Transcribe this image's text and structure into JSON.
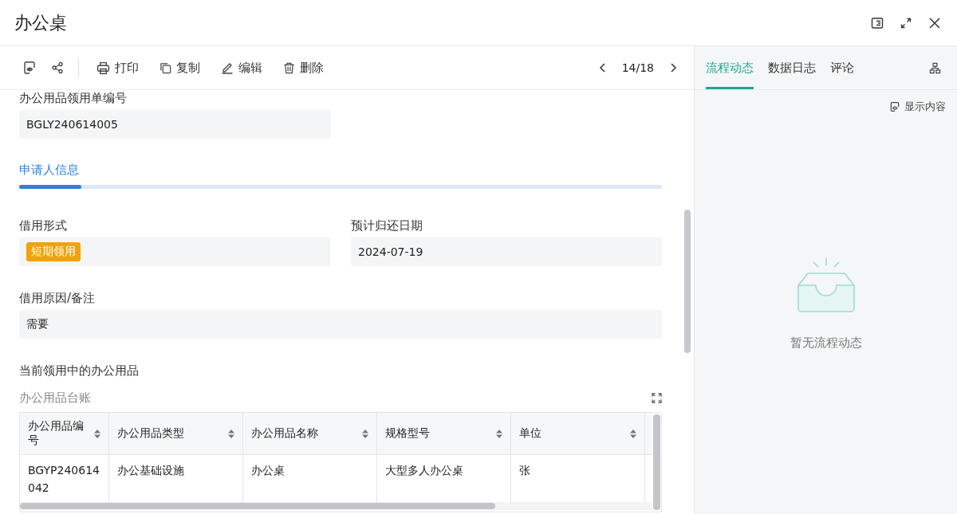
{
  "window": {
    "title": "办公桌"
  },
  "toolbar": {
    "actions": [
      {
        "kind": "print",
        "label": "打印"
      },
      {
        "kind": "copy",
        "label": "复制"
      },
      {
        "kind": "edit",
        "label": "编辑"
      },
      {
        "kind": "delete",
        "label": "删除"
      }
    ],
    "pager": "14/18"
  },
  "form": {
    "number_label": "办公用品领用单编号",
    "number_value": "BGLY240614005",
    "section": "申请人信息",
    "fields": [
      {
        "label": "借用形式",
        "kind": "tag",
        "value": "短期领用"
      },
      {
        "label": "预计归还日期",
        "kind": "text",
        "value": "2024-07-19"
      }
    ],
    "reason_label": "借用原因/备注",
    "reason_value": "需要",
    "current_label": "当前领用中的办公用品"
  },
  "table": {
    "title": "办公用品台账",
    "columns": [
      "办公用品编号",
      "办公用品类型",
      "办公用品名称",
      "规格型号",
      "单位"
    ],
    "rows": [
      [
        "BGYP240614042",
        "办公基础设施",
        "办公桌",
        "大型多人办公桌",
        "张"
      ]
    ]
  },
  "side": {
    "tabs": [
      {
        "label": "流程动态",
        "selected": true
      },
      {
        "label": "数据日志",
        "selected": false
      },
      {
        "label": "评论",
        "selected": false
      }
    ],
    "show_content": "显示内容",
    "empty": "暂无流程动态"
  }
}
